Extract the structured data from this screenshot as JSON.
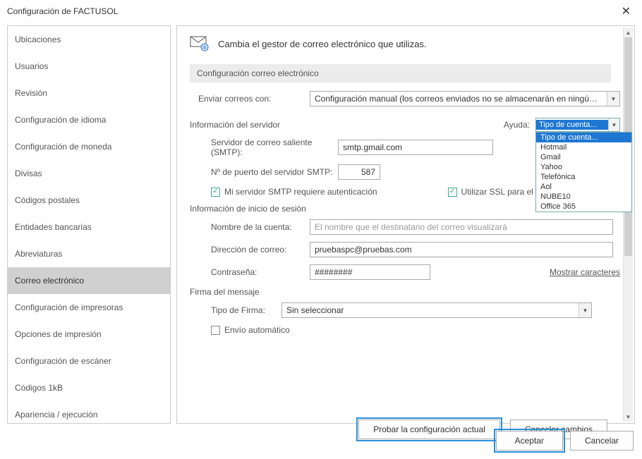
{
  "window": {
    "title": "Configuración de FACTUSOL"
  },
  "sidebar": {
    "items": [
      {
        "label": "Ubicaciones"
      },
      {
        "label": "Usuarios"
      },
      {
        "label": "Revisión"
      },
      {
        "label": "Configuración de idioma"
      },
      {
        "label": "Configuración de moneda"
      },
      {
        "label": "Divisas"
      },
      {
        "label": "Códigos postales"
      },
      {
        "label": "Entidades bancarias"
      },
      {
        "label": "Abreviaturas"
      },
      {
        "label": "Correo electrónico"
      },
      {
        "label": "Configuración de impresoras"
      },
      {
        "label": "Opciones de impresión"
      },
      {
        "label": "Configuración de escáner"
      },
      {
        "label": "Códigos 1kB"
      },
      {
        "label": "Apariencia / ejecución"
      }
    ],
    "selected_index": 9
  },
  "content": {
    "header": "Cambia el gestor de correo electrónico que utilizas.",
    "strip": "Configuración correo electrónico",
    "send_label": "Enviar correos con:",
    "send_value": "Configuración manual (los correos enviados no se almacenarán en ningún gestor d",
    "server_section": "Información del servidor",
    "help_label": "Ayuda:",
    "help_value": "Tipo de cuenta...",
    "help_options": [
      "Tipo de cuenta...",
      "Hotmail",
      "Gmail",
      "Yahoo",
      "Telefónica",
      "Aol",
      "NUBE10",
      "Office 365"
    ],
    "smtp_label": "Servidor de correo saliente (SMTP):",
    "smtp_value": "smtp.gmail.com",
    "port_label": "Nº de puerto del servidor SMTP:",
    "port_value": "587",
    "auth_cbx": "Mi servidor SMTP requiere autenticación",
    "ssl_cbx": "Utilizar SSL para el envío de",
    "login_section": "Información de inicio de sesión",
    "account_label": "Nombre de la cuenta:",
    "account_placeholder": "El nombre que el destinatario del correo visualizará",
    "email_label": "Dirección de correo:",
    "email_value": "pruebaspc@pruebas.com",
    "pw_label": "Contraseña:",
    "pw_value": "########",
    "pw_link": "Mostrar caracteres",
    "sign_section": "Firma del mensaje",
    "sign_type_label": "Tipo de Firma:",
    "sign_type_value": "Sin seleccionar",
    "auto_cbx": "Envío automático",
    "test_btn": "Probar la configuración actual",
    "cancel_changes_btn": "Cancelar cambios"
  },
  "footer": {
    "accept": "Aceptar",
    "cancel": "Cancelar"
  }
}
